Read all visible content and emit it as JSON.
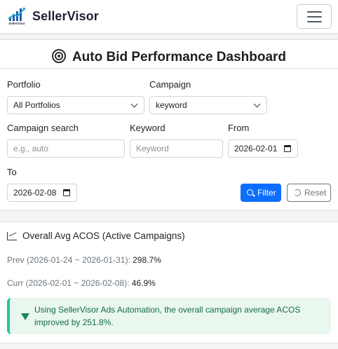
{
  "brand": {
    "name": "SellerVisor",
    "logo_text": "SellerVisor"
  },
  "page_title": "Auto Bid Performance Dashboard",
  "filters": {
    "portfolio_label": "Portfolio",
    "portfolio_value": "All Portfolios",
    "campaign_label": "Campaign",
    "campaign_value": "keyword",
    "campaign_search_label": "Campaign search",
    "campaign_search_placeholder": "e.g., auto",
    "keyword_label": "Keyword",
    "keyword_placeholder": "Keyword",
    "from_label": "From",
    "from_value": "2026-02-01",
    "to_label": "To",
    "to_value": "2026-02-08",
    "filter_button": "Filter",
    "reset_button": "Reset"
  },
  "summary": {
    "heading": "Overall Avg ACOS (Active Campaigns)",
    "prev_label": "Prev (2026-01-24 ~ 2026-01-31): ",
    "prev_value": "298.7%",
    "curr_label": "Curr (2026-02-01 ~ 2026-02-08): ",
    "curr_value": "46.9%",
    "alert_text": "Using SellerVisor Ads Automation, the overall campaign average ACOS improved by 251.8%."
  },
  "colors": {
    "primary": "#0d6efd",
    "success_bg": "#e9f7ef",
    "success_text": "#146c43",
    "success_border": "#20c997"
  }
}
